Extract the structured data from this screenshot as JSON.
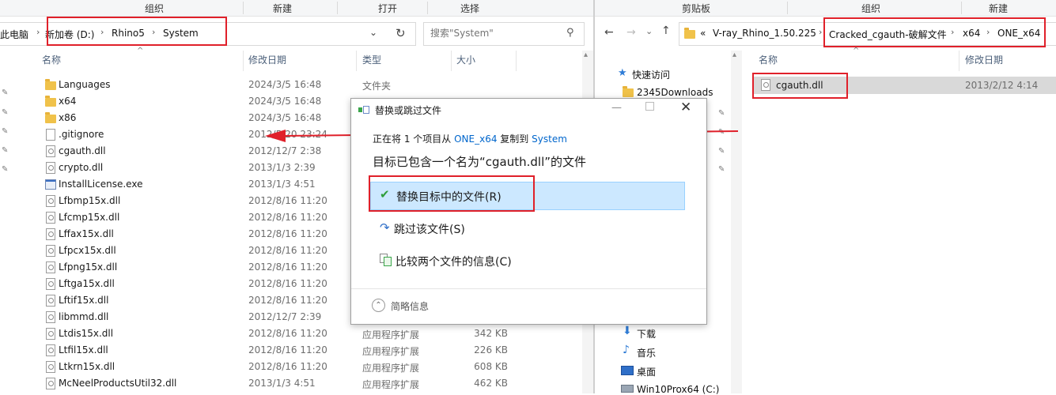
{
  "left_window": {
    "ribbon": {
      "groups": [
        "组织",
        "新建",
        "打开",
        "选择"
      ]
    },
    "address": {
      "crumbs": [
        "此电脑",
        "新加卷 (D:)",
        "Rhino5",
        "System"
      ]
    },
    "search": {
      "placeholder": "搜索\"System\""
    },
    "columns": {
      "name": "名称",
      "date": "修改日期",
      "type": "类型",
      "size": "大小"
    },
    "files": [
      {
        "name": "Languages",
        "date": "2024/3/5 16:48",
        "type": "文件夹",
        "size": "",
        "kind": "folder"
      },
      {
        "name": "x64",
        "date": "2024/3/5 16:48",
        "type": "",
        "size": "",
        "kind": "folder"
      },
      {
        "name": "x86",
        "date": "2024/3/5 16:48",
        "type": "",
        "size": "",
        "kind": "folder"
      },
      {
        "name": ".gitignore",
        "date": "2012/5/20 23:24",
        "type": "",
        "size": "",
        "kind": "file"
      },
      {
        "name": "cgauth.dll",
        "date": "2012/12/7 2:38",
        "type": "",
        "size": "",
        "kind": "dll"
      },
      {
        "name": "crypto.dll",
        "date": "2013/1/3 2:39",
        "type": "",
        "size": "",
        "kind": "dll"
      },
      {
        "name": "InstallLicense.exe",
        "date": "2013/1/3 4:51",
        "type": "",
        "size": "",
        "kind": "exe"
      },
      {
        "name": "Lfbmp15x.dll",
        "date": "2012/8/16 11:20",
        "type": "",
        "size": "",
        "kind": "dll"
      },
      {
        "name": "Lfcmp15x.dll",
        "date": "2012/8/16 11:20",
        "type": "",
        "size": "",
        "kind": "dll"
      },
      {
        "name": "Lffax15x.dll",
        "date": "2012/8/16 11:20",
        "type": "",
        "size": "",
        "kind": "dll"
      },
      {
        "name": "Lfpcx15x.dll",
        "date": "2012/8/16 11:20",
        "type": "",
        "size": "",
        "kind": "dll"
      },
      {
        "name": "Lfpng15x.dll",
        "date": "2012/8/16 11:20",
        "type": "",
        "size": "",
        "kind": "dll"
      },
      {
        "name": "Lftga15x.dll",
        "date": "2012/8/16 11:20",
        "type": "",
        "size": "",
        "kind": "dll"
      },
      {
        "name": "Lftif15x.dll",
        "date": "2012/8/16 11:20",
        "type": "",
        "size": "",
        "kind": "dll"
      },
      {
        "name": "libmmd.dll",
        "date": "2012/12/7 2:39",
        "type": "",
        "size": "",
        "kind": "dll"
      },
      {
        "name": "Ltdis15x.dll",
        "date": "2012/8/16 11:20",
        "type": "应用程序扩展",
        "size": "342 KB",
        "kind": "dll"
      },
      {
        "name": "Ltfil15x.dll",
        "date": "2012/8/16 11:20",
        "type": "应用程序扩展",
        "size": "226 KB",
        "kind": "dll"
      },
      {
        "name": "Ltkrn15x.dll",
        "date": "2012/8/16 11:20",
        "type": "应用程序扩展",
        "size": "608 KB",
        "kind": "dll"
      },
      {
        "name": "McNeelProductsUtil32.dll",
        "date": "2013/1/3 4:51",
        "type": "应用程序扩展",
        "size": "462 KB",
        "kind": "dll"
      }
    ]
  },
  "right_window": {
    "ribbon": {
      "groups": [
        "剪贴板",
        "组织",
        "新建"
      ]
    },
    "address": {
      "prefix": "«",
      "crumbs": [
        "V-ray_Rhino_1.50.225",
        "Cracked_cgauth-破解文件",
        "x64",
        "ONE_x64"
      ]
    },
    "columns": {
      "name": "名称",
      "date": "修改日期"
    },
    "nav": [
      "快速访问",
      "2345Downloads",
      "下载",
      "音乐",
      "桌面",
      "Win10Prox64 (C:)"
    ],
    "files": [
      {
        "name": "cgauth.dll",
        "date": "2013/2/12 4:14"
      }
    ]
  },
  "dialog": {
    "title": "替换或跳过文件",
    "copy_status_prefix": "正在将 1 个项目从",
    "source": "ONE_x64",
    "copy_status_mid": "复制到",
    "destination": "System",
    "message": "目标已包含一个名为“cgauth.dll”的文件",
    "options": {
      "replace": "替换目标中的文件(R)",
      "skip": "跳过该文件(S)",
      "compare": "比较两个文件的信息(C)"
    },
    "details_toggle": "简略信息"
  },
  "colors": {
    "highlight_red": "#e0202a",
    "link_blue": "#0066cc",
    "option_selected": "#cce8ff"
  }
}
